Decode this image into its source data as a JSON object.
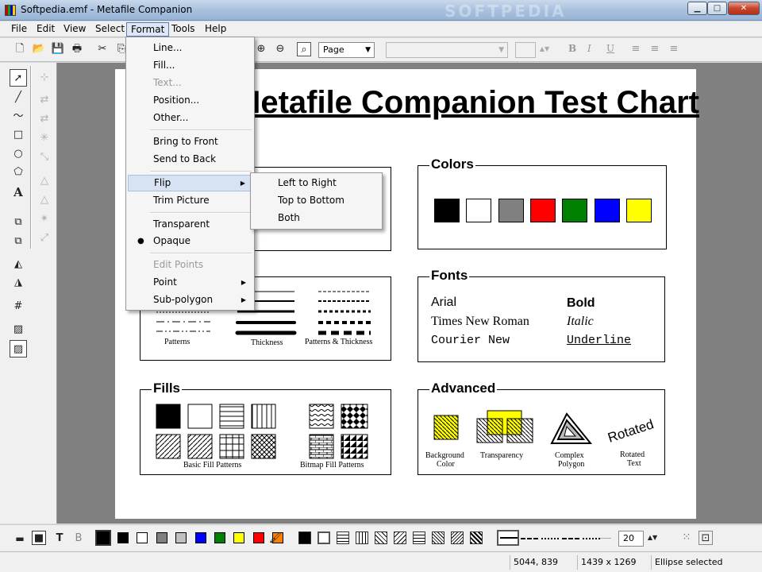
{
  "window": {
    "title": "Softpedia.emf - Metafile Companion",
    "watermark": "SOFTPEDIA"
  },
  "menubar": [
    "File",
    "Edit",
    "View",
    "Select",
    "Format",
    "Tools",
    "Help"
  ],
  "toolbar": {
    "zoom_select": "Page",
    "font_select": "",
    "format_bold": "B",
    "format_italic": "I",
    "format_underline": "U"
  },
  "format_menu": {
    "line": "Line...",
    "fill": "Fill...",
    "text": "Text...",
    "position": "Position...",
    "other": "Other...",
    "bring_front": "Bring to Front",
    "send_back": "Send to Back",
    "flip": "Flip",
    "trim": "Trim Picture",
    "transparent": "Transparent",
    "opaque": "Opaque",
    "edit_points": "Edit Points",
    "point": "Point",
    "sub_polygon": "Sub-polygon"
  },
  "flip_menu": {
    "left_right": "Left to Right",
    "top_bottom": "Top to Bottom",
    "both": "Both"
  },
  "page": {
    "title": "Metafile Companion Test Chart",
    "colors": {
      "title": "Colors",
      "swatches": [
        "#000000",
        "#ffffff",
        "#808080",
        "#ff0000",
        "#008000",
        "#0000ff",
        "#ffff00"
      ]
    },
    "lines": {
      "patterns": "Patterns",
      "thickness": "Thickness",
      "patterns_thickness": "Patterns & Thickness"
    },
    "fonts": {
      "title": "Fonts",
      "arial": "Arial",
      "bold": "Bold",
      "times": "Times New Roman",
      "italic": "Italic",
      "courier": "Courier New",
      "underline": "Underline"
    },
    "fills": {
      "title": "Fills",
      "basic": "Basic Fill Patterns",
      "bitmap": "Bitmap Fill Patterns"
    },
    "advanced": {
      "title": "Advanced",
      "background1": "Background",
      "background2": "Color",
      "transparency": "Transparency",
      "complex1": "Complex",
      "complex2": "Polygon",
      "rotated_label": "Rotated",
      "rotated1": "Rotated",
      "rotated2": "Text"
    }
  },
  "palette": {
    "colors": [
      "#000000",
      "#ffffff",
      "#808080",
      "#c0c0c0",
      "#0000ff",
      "#008000",
      "#ffff00",
      "#ff0000",
      "#ff8000"
    ],
    "line_width": "20"
  },
  "statusbar": {
    "coords": "5044, 839",
    "size": "1439 x 1269",
    "status": "Ellipse selected"
  }
}
